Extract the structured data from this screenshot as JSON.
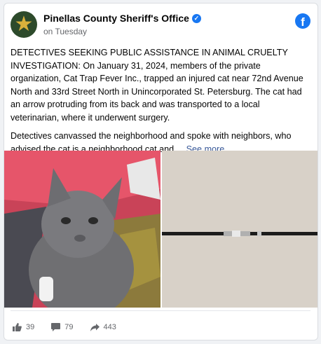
{
  "post": {
    "page_name": "Pinellas County Sheriff's Office",
    "timestamp": "on Tuesday",
    "paragraph1": "DETECTIVES SEEKING PUBLIC ASSISTANCE IN ANIMAL CRUELTY INVESTIGATION: On January 31, 2024, members of the private organization, Cat Trap Fever Inc., trapped an injured cat near 72nd Avenue North and 33rd Street North in Unincorporated St. Petersburg. The cat had an arrow protruding from its back and was transported to a local veterinarian, where it underwent surgery.",
    "paragraph2": "Detectives canvassed the neighborhood and spoke with neighbors, who advised the cat is a neighborhood cat and ...",
    "see_more": "See more"
  },
  "reactions": {
    "likes": "39",
    "comments": "79",
    "shares": "443"
  },
  "icons": {
    "verified": "verified-badge-icon",
    "facebook": "facebook-logo-icon",
    "like": "thumbs-up-icon",
    "comment": "comment-bubble-icon",
    "share": "share-arrow-icon"
  },
  "colors": {
    "facebook_blue": "#1877f2",
    "link": "#385898",
    "muted": "#65676b"
  }
}
